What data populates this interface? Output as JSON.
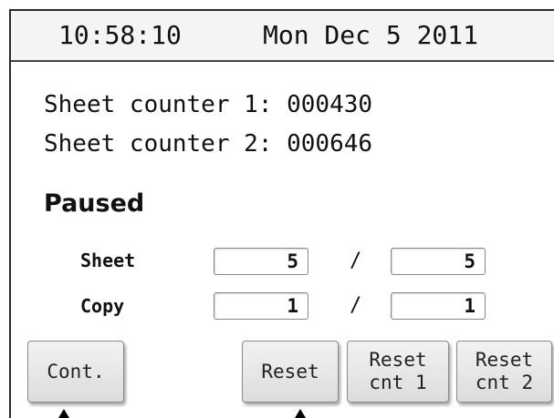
{
  "status": {
    "time": "10:58:10",
    "date": "Mon Dec 5 2011"
  },
  "counters": [
    {
      "label": "Sheet counter 1:",
      "value": "000430"
    },
    {
      "label": "Sheet counter 2:",
      "value": "000646"
    }
  ],
  "state": "Paused",
  "sheet": {
    "label": "Sheet",
    "current": "5",
    "separator": "/",
    "total": "5"
  },
  "copy": {
    "label": "Copy",
    "current": "1",
    "separator": "/",
    "total": "1"
  },
  "buttons": {
    "cont": "Cont.",
    "reset": "Reset",
    "reset_cnt1_line1": "Reset",
    "reset_cnt1_line2": "cnt 1",
    "reset_cnt2_line1": "Reset",
    "reset_cnt2_line2": "cnt 2"
  }
}
